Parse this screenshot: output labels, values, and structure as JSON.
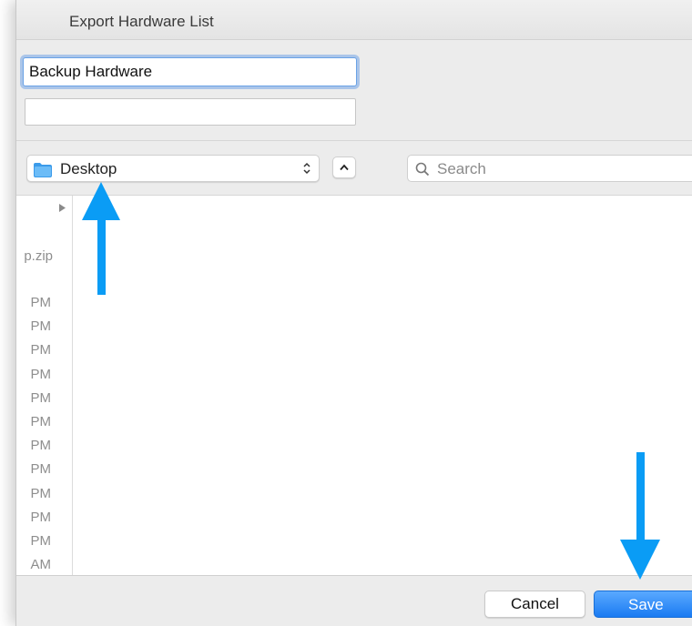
{
  "dialog": {
    "title": "Export Hardware List",
    "filename_value": "Backup Hardware",
    "tags_value": ""
  },
  "toolbar": {
    "location_label": "Desktop",
    "location_icon": "folder-icon",
    "search_placeholder": "Search"
  },
  "browser": {
    "partial_filename": "p.zip",
    "times": [
      "PM",
      "PM",
      "PM",
      "PM",
      "PM",
      "PM",
      "PM",
      "PM",
      "PM",
      "PM",
      "PM",
      "AM"
    ]
  },
  "footer": {
    "cancel_label": "Cancel",
    "save_label": "Save"
  },
  "colors": {
    "accent": "#1a7bf2",
    "annotation_arrow": "#0a9cf5"
  }
}
